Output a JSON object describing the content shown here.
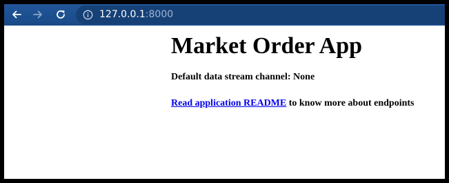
{
  "browser": {
    "url_host": "127.0.0.1",
    "url_port": ":8000",
    "icons": {
      "back": "arrow-left-icon",
      "forward": "arrow-right-icon",
      "reload": "reload-icon",
      "site_info": "info-circle-icon"
    },
    "colors": {
      "toolbar": "#1c4f8f",
      "omnibox": "#164177"
    }
  },
  "page": {
    "heading": "Market Order App",
    "channel_text": "Default data stream channel: None",
    "readme_link": "Read application README",
    "readme_suffix": " to know more about endpoints",
    "link_color": "#0000ee"
  }
}
